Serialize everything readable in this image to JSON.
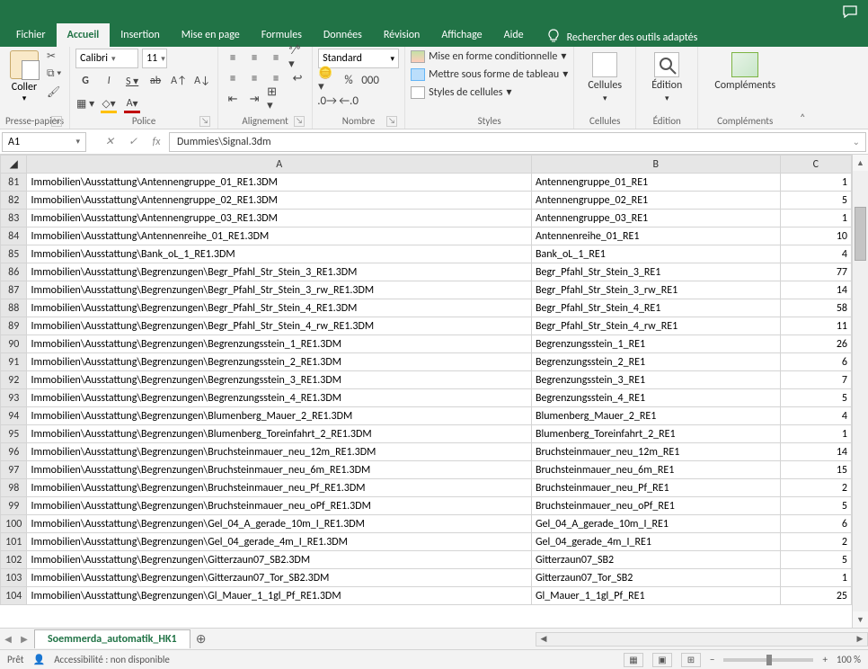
{
  "menu": {
    "tabs": [
      "Fichier",
      "Accueil",
      "Insertion",
      "Mise en page",
      "Formules",
      "Données",
      "Révision",
      "Affichage",
      "Aide"
    ],
    "active_index": 1,
    "search_placeholder": "Rechercher des outils adaptés"
  },
  "ribbon": {
    "clipboard": {
      "paste": "Coller",
      "label": "Presse-papiers"
    },
    "font": {
      "name": "Calibri",
      "size": "11",
      "label": "Police"
    },
    "align": {
      "label": "Alignement"
    },
    "number": {
      "format": "Standard",
      "label": "Nombre"
    },
    "styles": {
      "conditional": "Mise en forme conditionnelle",
      "table": "Mettre sous forme de tableau",
      "cellstyles": "Styles de cellules",
      "label": "Styles"
    },
    "cells": {
      "btn": "Cellules",
      "label": "Cellules"
    },
    "edit": {
      "btn": "Édition",
      "label": "Édition"
    },
    "comp": {
      "btn": "Compléments",
      "label": "Compléments"
    }
  },
  "namebox": "A1",
  "formula": "Dummies\\Signal.3dm",
  "columns": [
    "A",
    "B",
    "C"
  ],
  "rows": [
    {
      "n": 81,
      "a": "Immobilien\\Ausstattung\\Antennengruppe_01_RE1.3DM",
      "b": "Antennengruppe_01_RE1",
      "c": 1
    },
    {
      "n": 82,
      "a": "Immobilien\\Ausstattung\\Antennengruppe_02_RE1.3DM",
      "b": "Antennengruppe_02_RE1",
      "c": 5
    },
    {
      "n": 83,
      "a": "Immobilien\\Ausstattung\\Antennengruppe_03_RE1.3DM",
      "b": "Antennengruppe_03_RE1",
      "c": 1
    },
    {
      "n": 84,
      "a": "Immobilien\\Ausstattung\\Antennenreihe_01_RE1.3DM",
      "b": "Antennenreihe_01_RE1",
      "c": 10
    },
    {
      "n": 85,
      "a": "Immobilien\\Ausstattung\\Bank_oL_1_RE1.3DM",
      "b": "Bank_oL_1_RE1",
      "c": 4
    },
    {
      "n": 86,
      "a": "Immobilien\\Ausstattung\\Begrenzungen\\Begr_Pfahl_Str_Stein_3_RE1.3DM",
      "b": "Begr_Pfahl_Str_Stein_3_RE1",
      "c": 77
    },
    {
      "n": 87,
      "a": "Immobilien\\Ausstattung\\Begrenzungen\\Begr_Pfahl_Str_Stein_3_rw_RE1.3DM",
      "b": "Begr_Pfahl_Str_Stein_3_rw_RE1",
      "c": 14
    },
    {
      "n": 88,
      "a": "Immobilien\\Ausstattung\\Begrenzungen\\Begr_Pfahl_Str_Stein_4_RE1.3DM",
      "b": "Begr_Pfahl_Str_Stein_4_RE1",
      "c": 58
    },
    {
      "n": 89,
      "a": "Immobilien\\Ausstattung\\Begrenzungen\\Begr_Pfahl_Str_Stein_4_rw_RE1.3DM",
      "b": "Begr_Pfahl_Str_Stein_4_rw_RE1",
      "c": 11
    },
    {
      "n": 90,
      "a": "Immobilien\\Ausstattung\\Begrenzungen\\Begrenzungsstein_1_RE1.3DM",
      "b": "Begrenzungsstein_1_RE1",
      "c": 26
    },
    {
      "n": 91,
      "a": "Immobilien\\Ausstattung\\Begrenzungen\\Begrenzungsstein_2_RE1.3DM",
      "b": "Begrenzungsstein_2_RE1",
      "c": 6
    },
    {
      "n": 92,
      "a": "Immobilien\\Ausstattung\\Begrenzungen\\Begrenzungsstein_3_RE1.3DM",
      "b": "Begrenzungsstein_3_RE1",
      "c": 7
    },
    {
      "n": 93,
      "a": "Immobilien\\Ausstattung\\Begrenzungen\\Begrenzungsstein_4_RE1.3DM",
      "b": "Begrenzungsstein_4_RE1",
      "c": 5
    },
    {
      "n": 94,
      "a": "Immobilien\\Ausstattung\\Begrenzungen\\Blumenberg_Mauer_2_RE1.3DM",
      "b": "Blumenberg_Mauer_2_RE1",
      "c": 4
    },
    {
      "n": 95,
      "a": "Immobilien\\Ausstattung\\Begrenzungen\\Blumenberg_Toreinfahrt_2_RE1.3DM",
      "b": "Blumenberg_Toreinfahrt_2_RE1",
      "c": 1
    },
    {
      "n": 96,
      "a": "Immobilien\\Ausstattung\\Begrenzungen\\Bruchsteinmauer_neu_12m_RE1.3DM",
      "b": "Bruchsteinmauer_neu_12m_RE1",
      "c": 14
    },
    {
      "n": 97,
      "a": "Immobilien\\Ausstattung\\Begrenzungen\\Bruchsteinmauer_neu_6m_RE1.3DM",
      "b": "Bruchsteinmauer_neu_6m_RE1",
      "c": 15
    },
    {
      "n": 98,
      "a": "Immobilien\\Ausstattung\\Begrenzungen\\Bruchsteinmauer_neu_Pf_RE1.3DM",
      "b": "Bruchsteinmauer_neu_Pf_RE1",
      "c": 2
    },
    {
      "n": 99,
      "a": "Immobilien\\Ausstattung\\Begrenzungen\\Bruchsteinmauer_neu_oPf_RE1.3DM",
      "b": "Bruchsteinmauer_neu_oPf_RE1",
      "c": 5
    },
    {
      "n": 100,
      "a": "Immobilien\\Ausstattung\\Begrenzungen\\Gel_04_A_gerade_10m_I_RE1.3DM",
      "b": "Gel_04_A_gerade_10m_I_RE1",
      "c": 6
    },
    {
      "n": 101,
      "a": "Immobilien\\Ausstattung\\Begrenzungen\\Gel_04_gerade_4m_I_RE1.3DM",
      "b": "Gel_04_gerade_4m_I_RE1",
      "c": 2
    },
    {
      "n": 102,
      "a": "Immobilien\\Ausstattung\\Begrenzungen\\Gitterzaun07_SB2.3DM",
      "b": "Gitterzaun07_SB2",
      "c": 5
    },
    {
      "n": 103,
      "a": "Immobilien\\Ausstattung\\Begrenzungen\\Gitterzaun07_Tor_SB2.3DM",
      "b": "Gitterzaun07_Tor_SB2",
      "c": 1
    },
    {
      "n": 104,
      "a": "Immobilien\\Ausstattung\\Begrenzungen\\Gl_Mauer_1_1gl_Pf_RE1.3DM",
      "b": "Gl_Mauer_1_1gl_Pf_RE1",
      "c": 25
    }
  ],
  "sheet_tab": "Soemmerda_automatik_HK1",
  "status": {
    "ready": "Prêt",
    "accessibility": "Accessibilité : non disponible",
    "zoom": "100 %"
  }
}
